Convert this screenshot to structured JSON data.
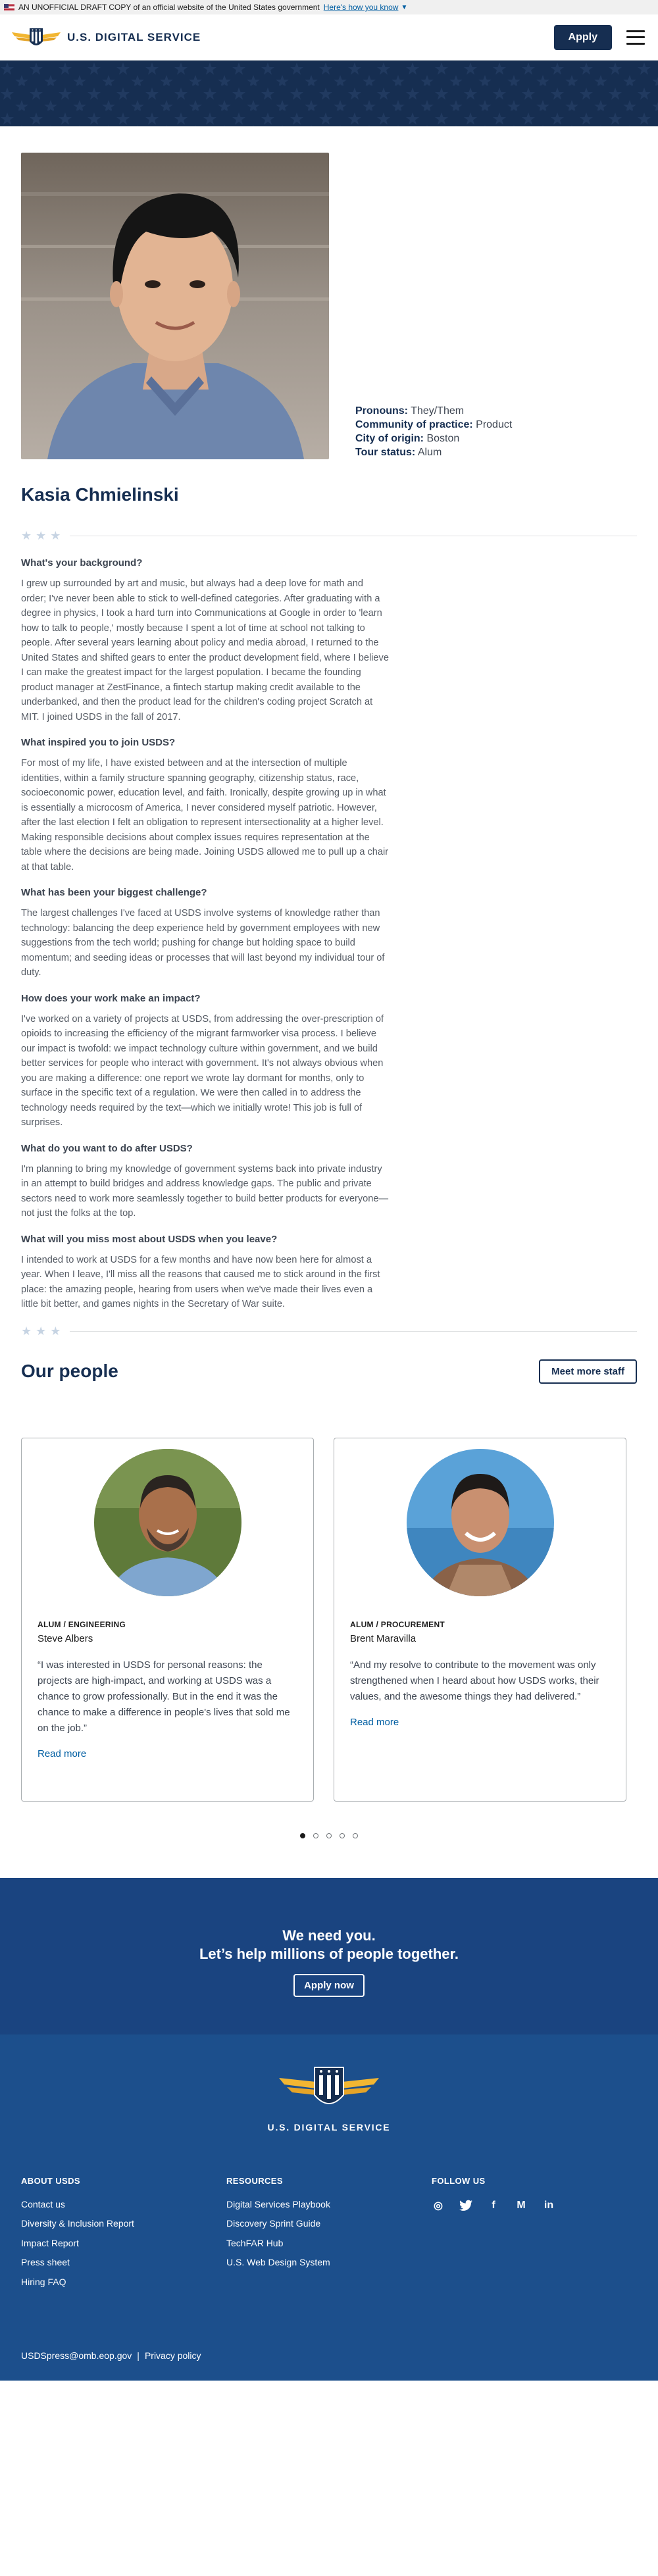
{
  "gov_banner": {
    "text": "AN UNOFFICIAL DRAFT COPY of an official website of the United States government",
    "link": "Here's how you know"
  },
  "header": {
    "logo_text": "U.S. DIGITAL SERVICE",
    "apply_label": "Apply"
  },
  "profile": {
    "facts": [
      {
        "key": "Pronouns:",
        "value": "They/Them"
      },
      {
        "key": "Community of practice:",
        "value": "Product"
      },
      {
        "key": "City of origin:",
        "value": "Boston"
      },
      {
        "key": "Tour status:",
        "value": "Alum"
      }
    ],
    "name": "Kasia Chmielinski",
    "qa": [
      {
        "q": "What's your background?",
        "a": "I grew up surrounded by art and music, but always had a deep love for math and order; I've never been able to stick to well-defined categories. After graduating with a degree in physics, I took a hard turn into Communications at Google in order to 'learn how to talk to people,' mostly because I spent a lot of time at school not talking to people. After several years learning about policy and media abroad, I returned to the United States and shifted gears to enter the product development field, where I believe I can make the greatest impact for the largest population. I became the founding product manager at ZestFinance, a fintech startup making credit available to the underbanked, and then the product lead for the children's coding project Scratch at MIT. I joined USDS in the fall of 2017."
      },
      {
        "q": "What inspired you to join USDS?",
        "a": "For most of my life, I have existed between and at the intersection of multiple identities, within a family structure spanning geography, citizenship status, race, socioeconomic power, education level, and faith. Ironically, despite growing up in what is essentially a microcosm of America, I never considered myself patriotic. However, after the last election I felt an obligation to represent intersectionality at a higher level. Making responsible decisions about complex issues requires representation at the table where the decisions are being made. Joining USDS allowed me to pull up a chair at that table."
      },
      {
        "q": "What has been your biggest challenge?",
        "a": "The largest challenges I've faced at USDS involve systems of knowledge rather than technology: balancing the deep experience held by government employees with new suggestions from the tech world; pushing for change but holding space to build momentum; and seeding ideas or processes that will last beyond my individual tour of duty."
      },
      {
        "q": "How does your work make an impact?",
        "a": "I've worked on a variety of projects at USDS, from addressing the over-prescription of opioids to increasing the efficiency of the migrant farmworker visa process. I believe our impact is twofold: we impact technology culture within government, and we build better services for people who interact with government. It's not always obvious when you are making a difference: one report we wrote lay dormant for months, only to surface in the specific text of a regulation. We were then called in to address the technology needs required by the text—which we initially wrote! This job is full of surprises."
      },
      {
        "q": "What do you want to do after USDS?",
        "a": "I'm planning to bring my knowledge of government systems back into private industry in an attempt to build bridges and address knowledge gaps. The public and private sectors need to work more seamlessly together to build better products for everyone—not just the folks at the top."
      },
      {
        "q": "What will you miss most about USDS when you leave?",
        "a": "I intended to work at USDS for a few months and have now been here for almost a year. When I leave, I'll miss all the reasons that caused me to stick around in the first place: the amazing people, hearing from users when we've made their lives even a little bit better, and games nights in the Secretary of War suite."
      }
    ]
  },
  "people": {
    "title": "Our people",
    "more_label": "Meet more staff",
    "cards": [
      {
        "role": "ALUM / ENGINEERING",
        "name": "Steve Albers",
        "quote": "“I was interested in USDS for personal reasons: the projects are high-impact, and working at USDS was a chance to grow professionally. But in the end it was the chance to make a difference in people's lives that sold me on the job.”",
        "read": "Read more"
      },
      {
        "role": "ALUM / PROCUREMENT",
        "name": "Brent Maravilla",
        "quote": "“And my resolve to contribute to the movement was only strengthened when I heard about how USDS works, their values, and the awesome things they had delivered.”",
        "read": "Read more"
      }
    ],
    "carousel": {
      "total": 5,
      "active": 1
    }
  },
  "cta": {
    "line1": "We need you.",
    "line2": "Let’s help millions of people together.",
    "button": "Apply now"
  },
  "footer": {
    "logo_text": "U.S. DIGITAL SERVICE",
    "about": {
      "heading": "ABOUT USDS",
      "links": [
        "Contact us",
        "Diversity & Inclusion Report",
        "Impact Report",
        "Press sheet",
        "Hiring FAQ"
      ]
    },
    "resources": {
      "heading": "RESOURCES",
      "links": [
        "Digital Services Playbook",
        "Discovery Sprint Guide",
        "TechFAR Hub",
        "U.S. Web Design System"
      ]
    },
    "follow": {
      "heading": "FOLLOW US",
      "icons": [
        "instagram-icon",
        "twitter-icon",
        "facebook-icon",
        "medium-icon",
        "linkedin-icon"
      ],
      "glyphs": [
        "◎",
        "ṫ",
        "f",
        "M",
        "in"
      ]
    },
    "email": "USDSpress@omb.eop.gov",
    "privacy": "Privacy policy"
  },
  "colors": {
    "navy": "#162e51",
    "cta_blue": "#1a4480",
    "footer_blue": "#1c4f8c",
    "link_blue": "#005ea2"
  }
}
